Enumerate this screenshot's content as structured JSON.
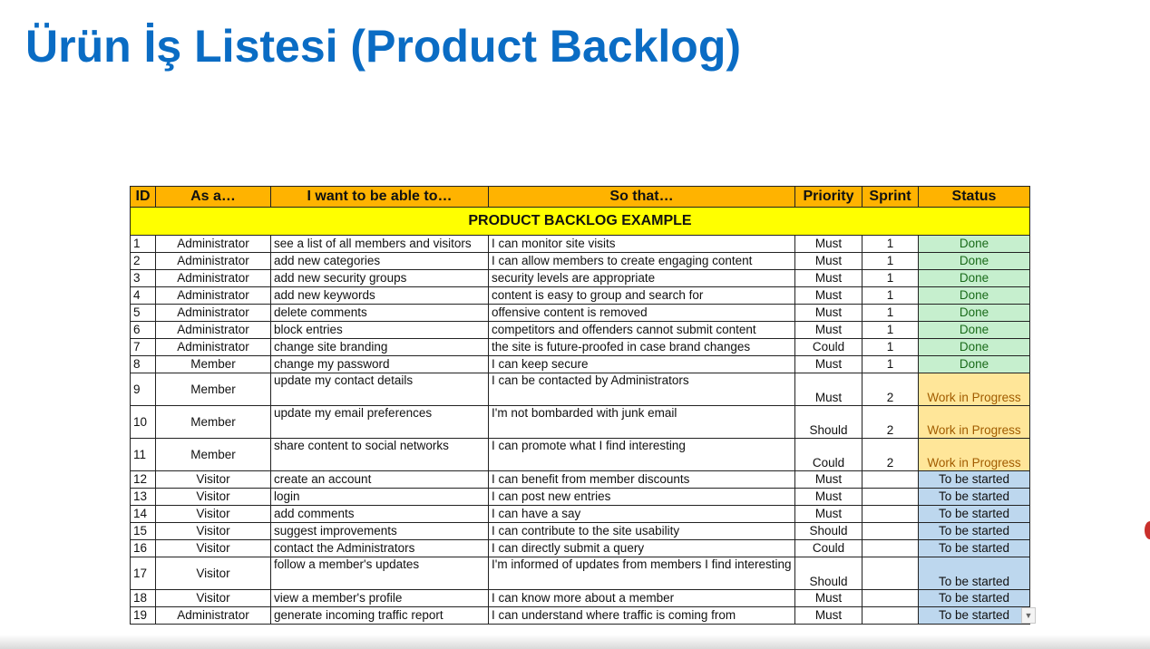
{
  "slide": {
    "title": "Ürün İş Listesi (Product Backlog)"
  },
  "sheet": {
    "banner": "PRODUCT BACKLOG EXAMPLE",
    "headers": [
      "ID",
      "As a…",
      "I want to be able to…",
      "So that…",
      "Priority",
      "Sprint",
      "Status"
    ],
    "rows": [
      [
        "1",
        "Administrator",
        "see a list of all members and visitors",
        "I can monitor site visits",
        "Must",
        "1",
        "Done"
      ],
      [
        "2",
        "Administrator",
        "add new categories",
        "I can allow members to create engaging content",
        "Must",
        "1",
        "Done"
      ],
      [
        "3",
        "Administrator",
        "add new security groups",
        "security levels are appropriate",
        "Must",
        "1",
        "Done"
      ],
      [
        "4",
        "Administrator",
        "add new keywords",
        "content is easy to group and search for",
        "Must",
        "1",
        "Done"
      ],
      [
        "5",
        "Administrator",
        "delete comments",
        "offensive content is removed",
        "Must",
        "1",
        "Done"
      ],
      [
        "6",
        "Administrator",
        "block entries",
        "competitors and offenders cannot submit content",
        "Must",
        "1",
        "Done"
      ],
      [
        "7",
        "Administrator",
        "change site branding",
        "the site is future-proofed in case brand changes",
        "Could",
        "1",
        "Done"
      ],
      [
        "8",
        "Member",
        "change my password",
        "I can keep secure",
        "Must",
        "1",
        "Done"
      ],
      [
        "9",
        "Member",
        "update my contact details",
        "I can be contacted by Administrators",
        "Must",
        "2",
        "Work in Progress"
      ],
      [
        "10",
        "Member",
        "update my email preferences",
        "I'm not bombarded with junk email",
        "Should",
        "2",
        "Work in Progress"
      ],
      [
        "11",
        "Member",
        "share content to social networks",
        "I can promote what I find interesting",
        "Could",
        "2",
        "Work in Progress"
      ],
      [
        "12",
        "Visitor",
        "create an account",
        "I can benefit from member discounts",
        "Must",
        "",
        "To be started"
      ],
      [
        "13",
        "Visitor",
        "login",
        "I can post new entries",
        "Must",
        "",
        "To be started"
      ],
      [
        "14",
        "Visitor",
        "add comments",
        "I can have a say",
        "Must",
        "",
        "To be started"
      ],
      [
        "15",
        "Visitor",
        "suggest improvements",
        "I can contribute to the site usability",
        "Should",
        "",
        "To be started"
      ],
      [
        "16",
        "Visitor",
        "contact the Administrators",
        "I can directly submit a query",
        "Could",
        "",
        "To be started"
      ],
      [
        "17",
        "Visitor",
        "follow a member's updates",
        "I'm informed of updates from members I find interesting",
        "Should",
        "",
        "To be started"
      ],
      [
        "18",
        "Visitor",
        "view a  member's profile",
        "I can know more about a member",
        "Must",
        "",
        "To be started"
      ],
      [
        "19",
        "Administrator",
        "generate incoming traffic report",
        "I can understand where traffic is coming from",
        "Must",
        "",
        "To be started"
      ]
    ],
    "tall_rows": [
      "9",
      "10",
      "11",
      "17"
    ],
    "status_colors": {
      "Done": "#c6efce",
      "Work in Progress": "#ffe699",
      "To be started": "#bdd7ee"
    },
    "dropdown_icon": "chevron-down-icon"
  }
}
